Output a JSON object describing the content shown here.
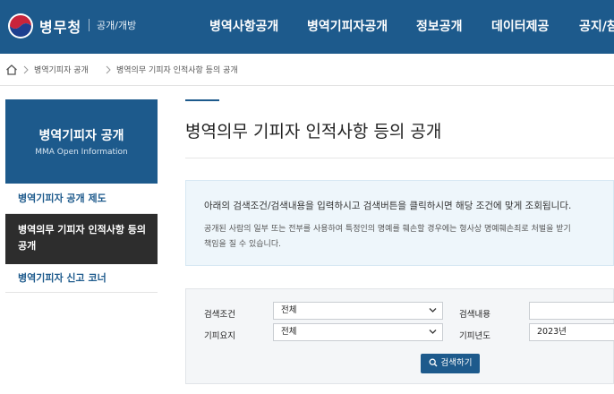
{
  "header": {
    "brand": "병무청",
    "brand_sub": "공개/개방",
    "nav": [
      "병역사항공개",
      "병역기피자공개",
      "정보공개",
      "데이터제공",
      "공지/참"
    ]
  },
  "breadcrumb": [
    "병역기피자 공개",
    "병역의무 기피자 인적사항 등의 공개"
  ],
  "sidebar": {
    "title": "병역기피자 공개",
    "subtitle": "MMA Open Information",
    "items": [
      {
        "label": "병역기피자 공개 제도"
      },
      {
        "label": "병역의무 기피자 인적사항 등의 공개"
      },
      {
        "label": "병역기피자 신고 코너"
      }
    ]
  },
  "main": {
    "title": "병역의무 기피자 인적사항 등의 공개",
    "notice": {
      "line1": "아래의 검색조건/검색내용을 입력하시고 검색버튼을 클릭하시면 해당 조건에 맞게 조회됩니다.",
      "line2": "공개된 사람의 일부 또는 전부를 사용하여 특정인의 명예를 훼손할 경우에는 형사상 명예훼손죄로 처벌을 받기",
      "line3": "책임을 질 수 있습니다."
    },
    "search": {
      "condition_label": "검색조건",
      "condition_value": "전체",
      "content_label": "검색내용",
      "content_value": "",
      "summary_label": "기피요지",
      "summary_value": "전체",
      "year_label": "기피년도",
      "year_value": "2023년",
      "button_label": "검색하기"
    }
  },
  "colors": {
    "brand": "#1d5a8c",
    "active_item": "#2d2d2d",
    "notice_bg": "#eef6fb"
  }
}
